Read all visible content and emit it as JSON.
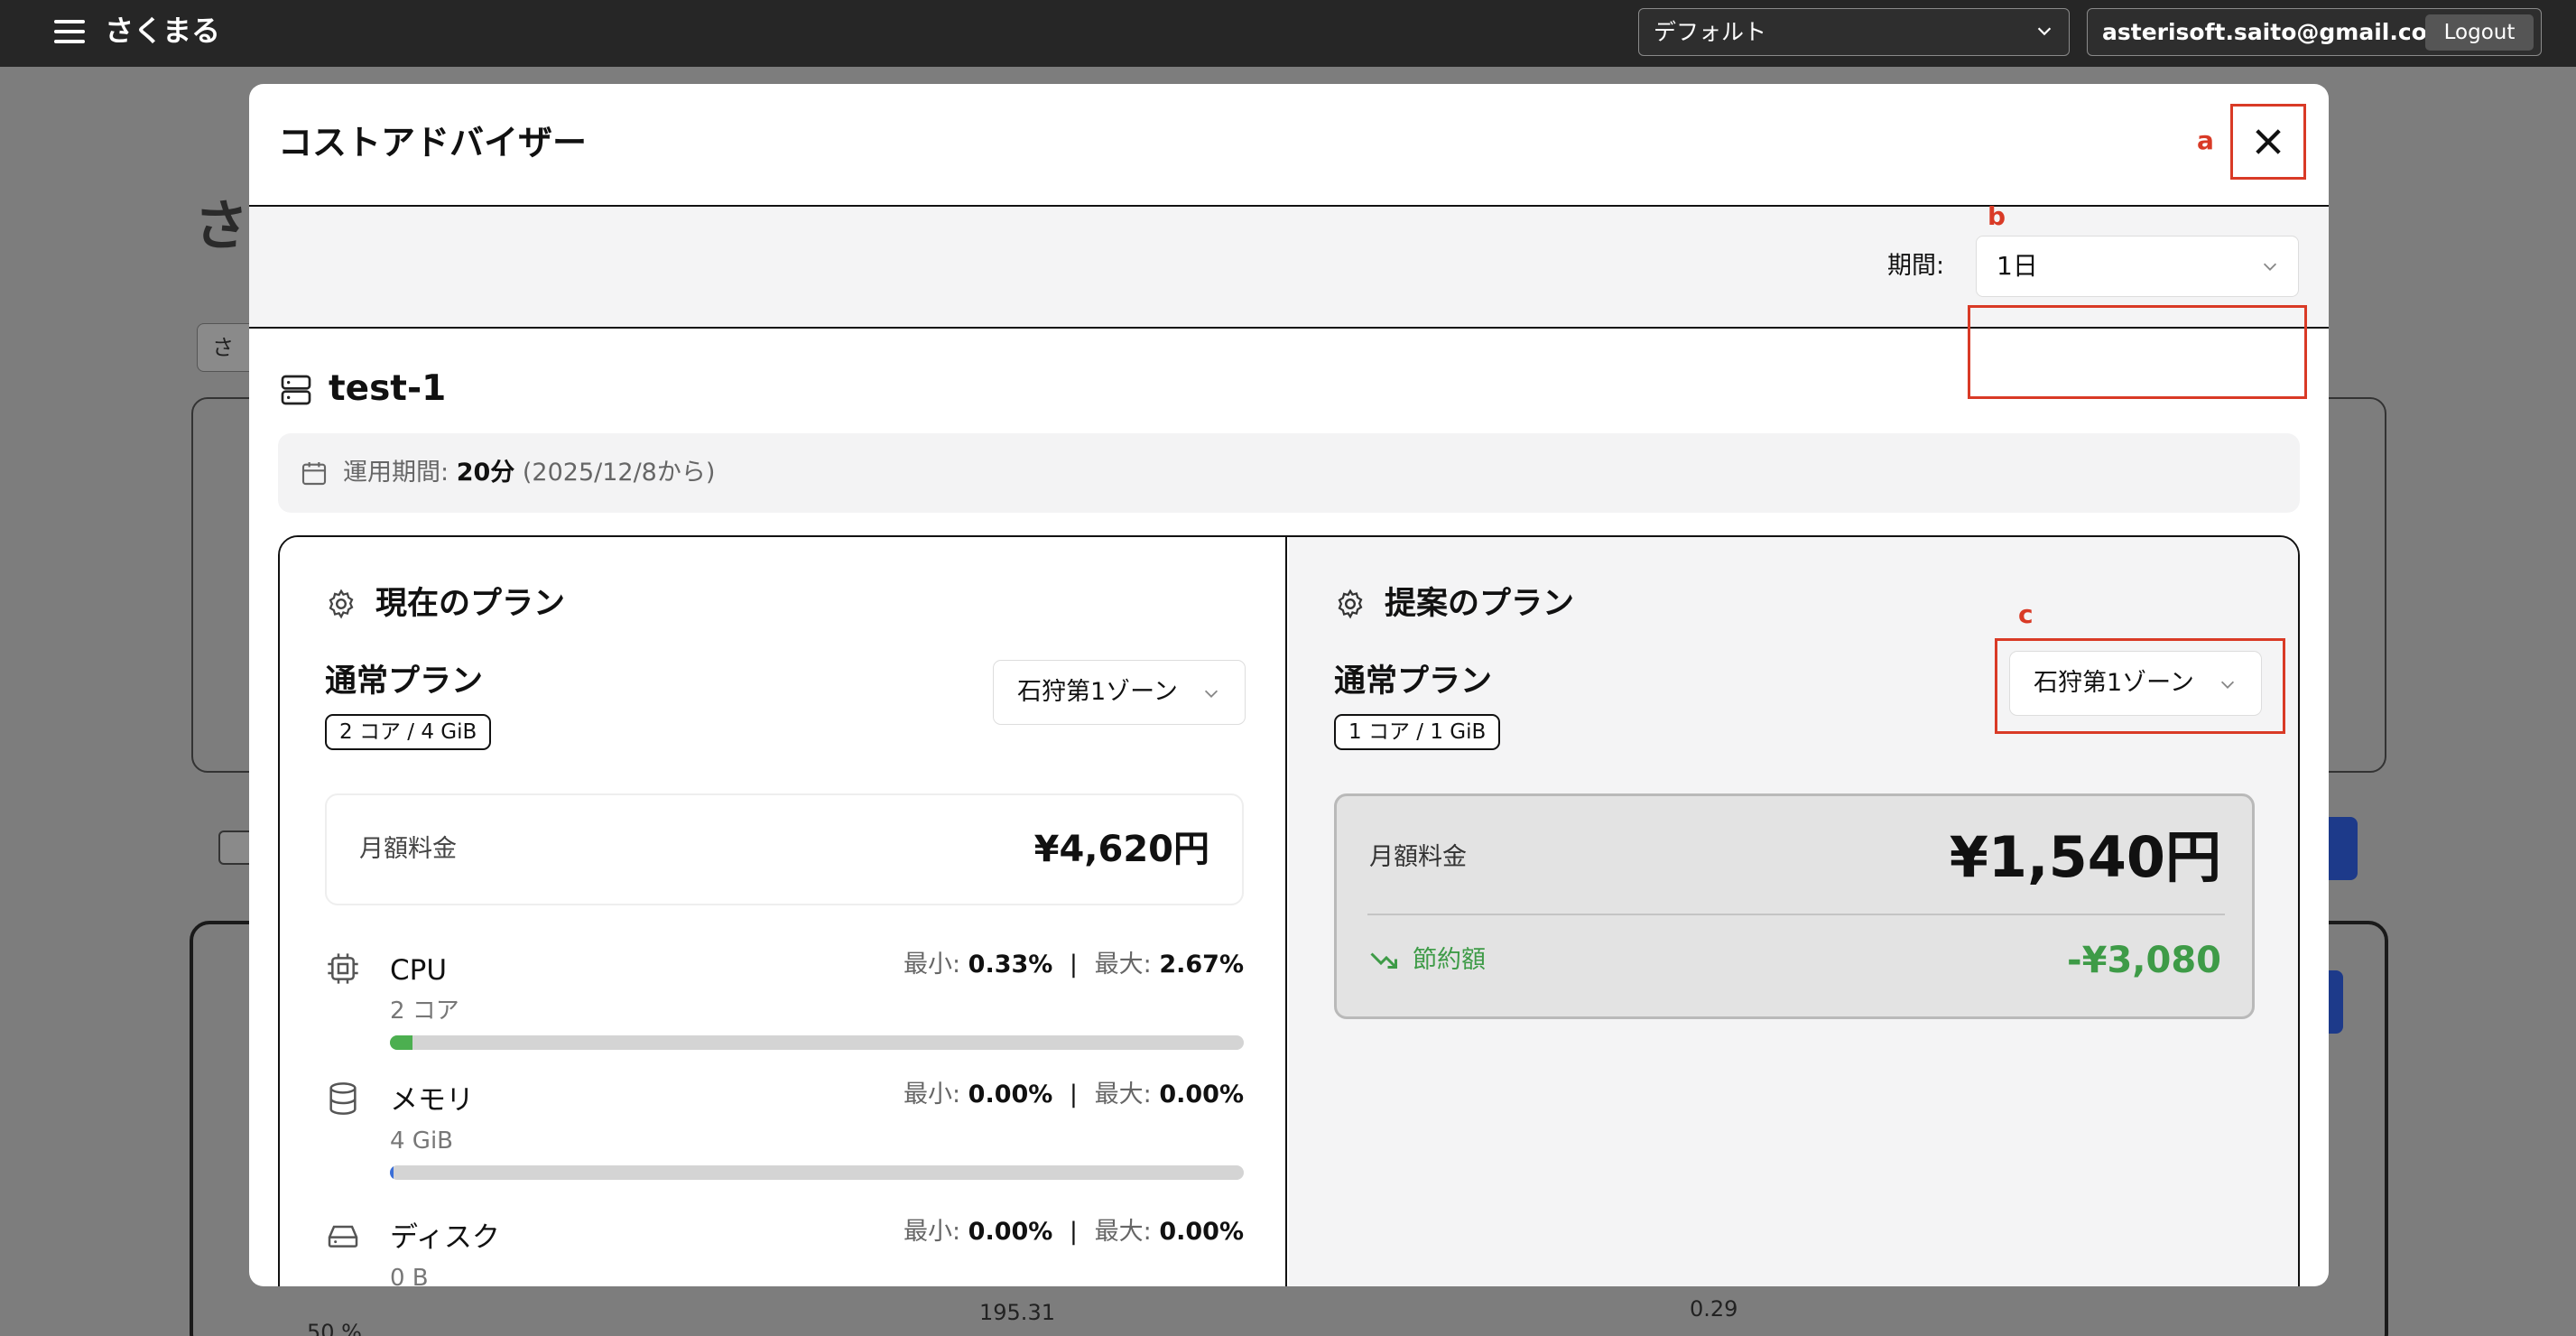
{
  "topbar": {
    "app_title": "さくまる",
    "workspace": "デフォルト",
    "user_email": "asterisoft.saito@gmail.com",
    "logout_label": "Logout"
  },
  "background": {
    "heading": "さ",
    "chip": "さ",
    "axis_labels": [
      "195.31",
      "0.29",
      "50 %"
    ]
  },
  "modal": {
    "title": "コストアドバイザー",
    "annotations": {
      "a": "a",
      "b": "b",
      "c": "c"
    },
    "period": {
      "label": "期間:",
      "value": "1日"
    },
    "server": {
      "name": "test-1"
    },
    "uptime": {
      "label": "運用期間:",
      "duration": "20分",
      "since": "(2025/12/8から)"
    },
    "current_plan": {
      "section_title": "現在のプラン",
      "plan_name": "通常プラン",
      "spec": "2 コア / 4 GiB",
      "zone": "石狩第1ゾーン",
      "monthly_label": "月額料金",
      "monthly_price": "¥4,620円",
      "metrics": [
        {
          "name": "CPU",
          "sub": "2 コア",
          "min_label": "最小:",
          "min": "0.33%",
          "max_label": "最大:",
          "max": "2.67%",
          "sep": "|",
          "usage": 2.67,
          "color": "#4caf50"
        },
        {
          "name": "メモリ",
          "sub": "4 GiB",
          "min_label": "最小:",
          "min": "0.00%",
          "max_label": "最大:",
          "max": "0.00%",
          "sep": "|",
          "usage": 0.4,
          "color": "#3b6fd8"
        },
        {
          "name": "ディスク",
          "sub": "0 B",
          "min_label": "最小:",
          "min": "0.00%",
          "max_label": "最大:",
          "max": "0.00%",
          "sep": "|",
          "usage": 0,
          "color": "#3b6fd8"
        }
      ]
    },
    "proposed_plan": {
      "section_title": "提案のプラン",
      "plan_name": "通常プラン",
      "spec": "1 コア / 1 GiB",
      "zone": "石狩第1ゾーン",
      "monthly_label": "月額料金",
      "monthly_price": "¥1,540円",
      "savings_label": "節約額",
      "savings_value": "-¥3,080"
    }
  },
  "colors": {
    "accent_red": "#d93a26",
    "savings_green": "#3e9b47"
  }
}
